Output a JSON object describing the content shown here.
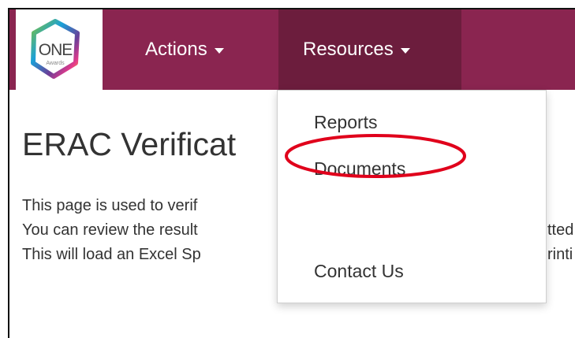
{
  "brand": {
    "logo_text": "ONE",
    "logo_sub": "Awards"
  },
  "nav": {
    "actions_label": "Actions",
    "resources_label": "Resources"
  },
  "dropdown": {
    "items": [
      "Reports",
      "Documents",
      "Contact Us"
    ],
    "highlight_color": "#e0001b"
  },
  "main": {
    "title": "ERAC Verificat",
    "paragraphs": [
      "This page is used to verif",
      "You can review the result",
      "This will load an Excel Sp"
    ],
    "clipped_right": [
      "tted",
      "rinti"
    ]
  },
  "colors": {
    "navbar": "#8a2550",
    "navbar_active": "#6c1d3d"
  }
}
